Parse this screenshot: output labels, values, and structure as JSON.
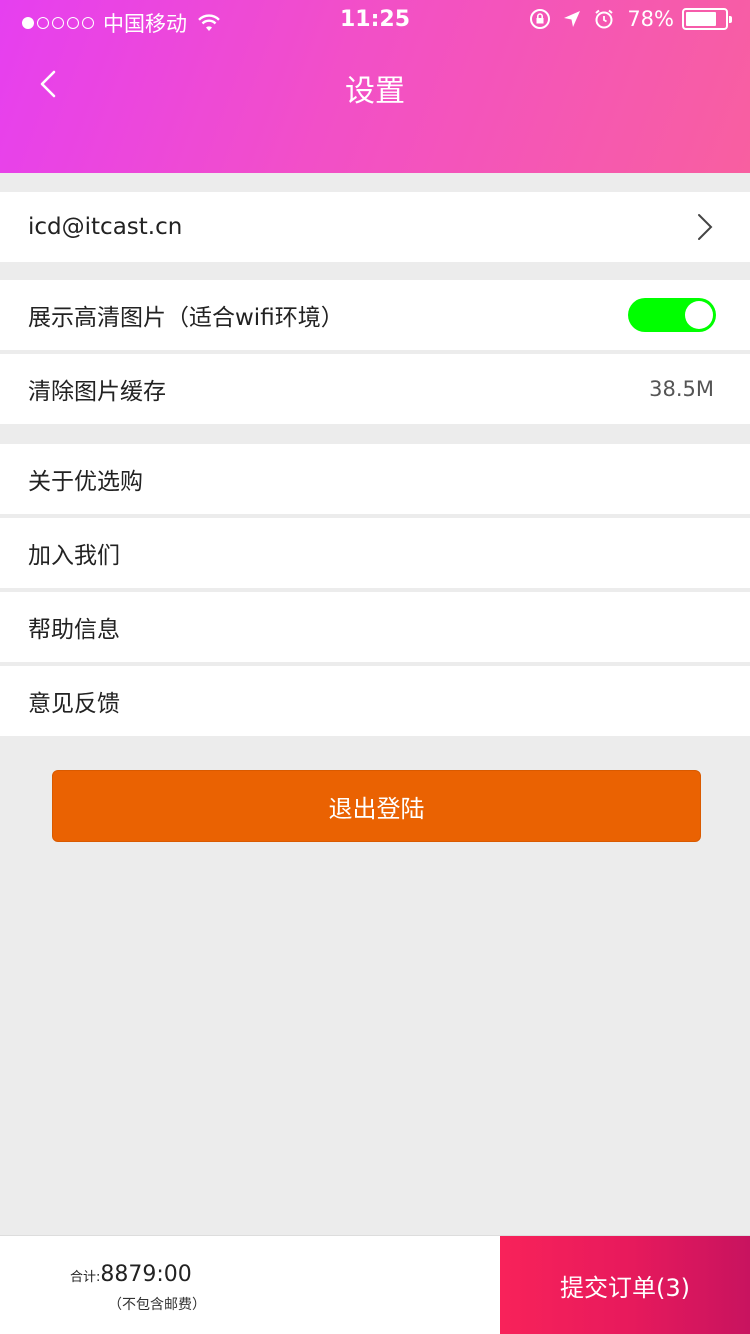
{
  "status_bar": {
    "carrier": "中国移动",
    "time": "11:25",
    "battery_percent": "78%",
    "battery_level": 0.78,
    "icons": [
      "signal-dots",
      "wifi-icon",
      "rotation-lock-icon",
      "location-arrow-icon",
      "alarm-icon",
      "battery-icon"
    ]
  },
  "header": {
    "title": "设置",
    "back_icon": "chevron-left-icon",
    "gradient_colors": [
      "#e63ff0",
      "#f85fa0"
    ]
  },
  "settings": {
    "account": {
      "label": "icd@itcast.cn",
      "icon": "chevron-right-icon"
    },
    "hd_images": {
      "label": "展示高清图片（适合wifi环境）",
      "enabled": true,
      "toggle_color": "#00ff00"
    },
    "clear_cache": {
      "label": "清除图片缓存",
      "value": "38.5M"
    },
    "about": {
      "label": "关于优选购"
    },
    "join": {
      "label": "加入我们"
    },
    "help": {
      "label": "帮助信息"
    },
    "feedback": {
      "label": "意见反馈"
    }
  },
  "logout": {
    "label": "退出登陆",
    "color": "#ea6202"
  },
  "bottom_bar": {
    "total_label": "合计:",
    "total_amount": "8879:00",
    "note": "（不包含邮费）",
    "submit_label": "提交订单(3)",
    "submit_color": "#f8225a"
  }
}
